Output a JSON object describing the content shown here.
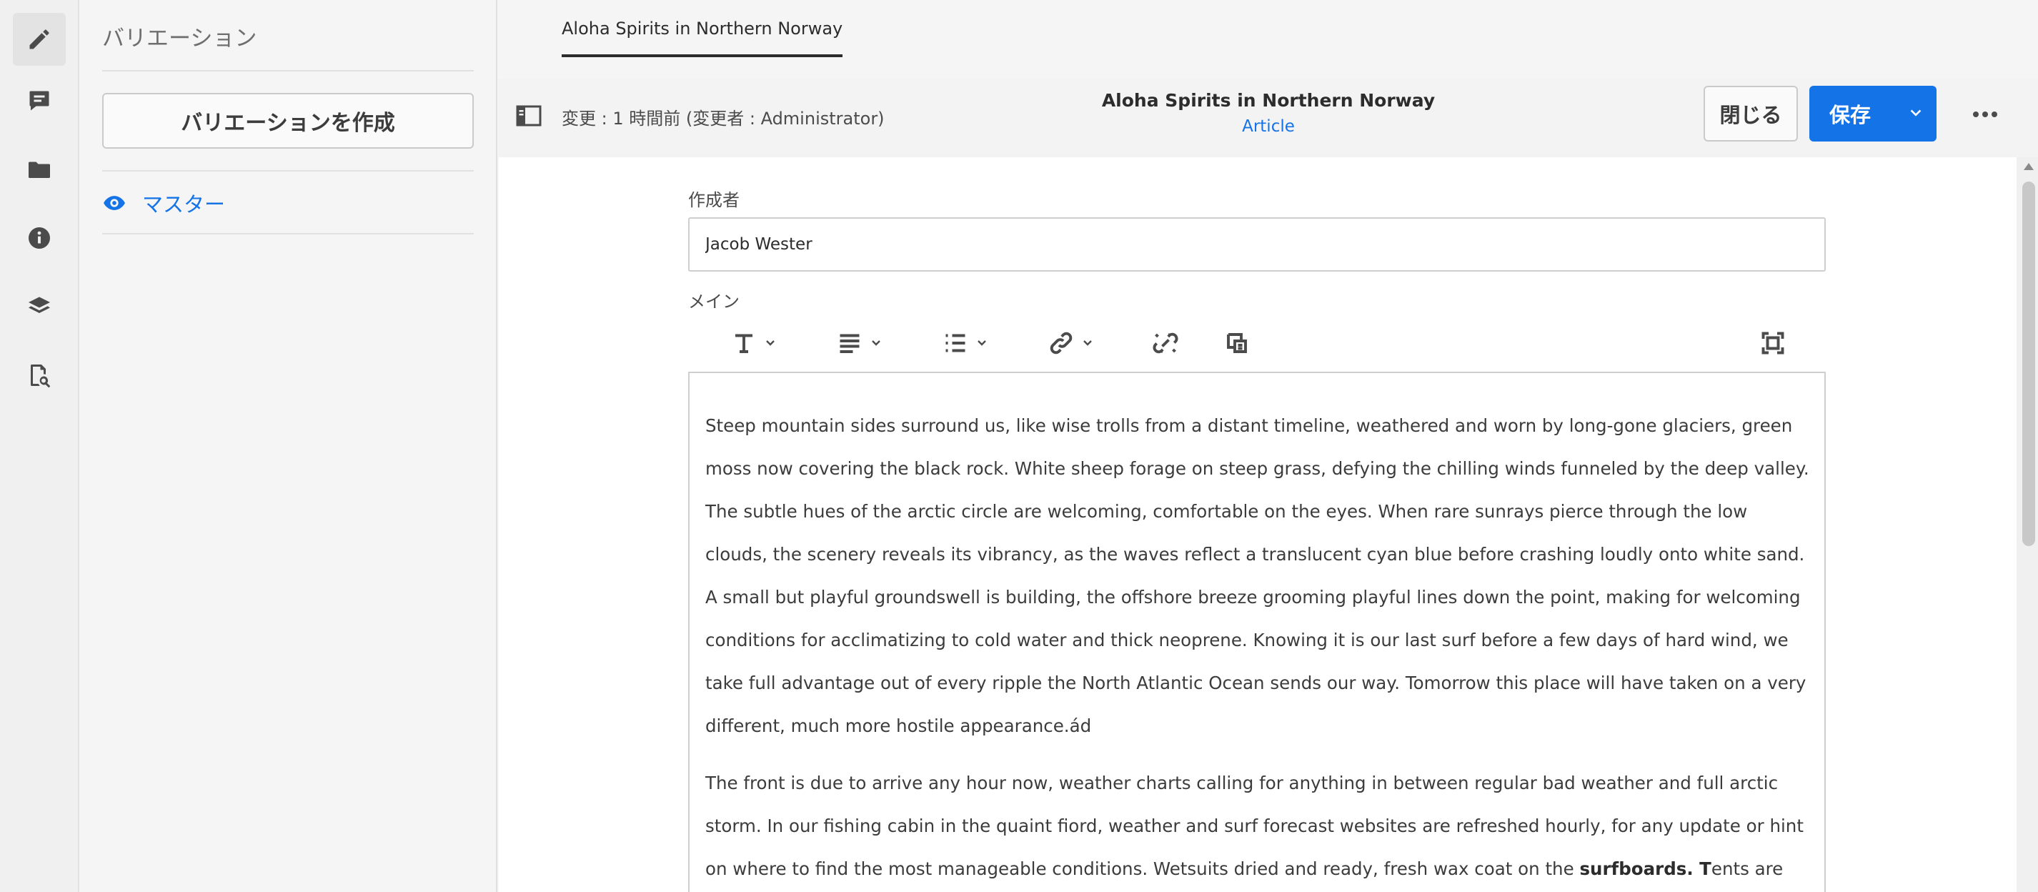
{
  "rail": {
    "items": [
      "edit-icon",
      "comment-icon",
      "folder-icon",
      "info-icon",
      "layers-icon",
      "search-doc-icon"
    ],
    "active": "edit-icon"
  },
  "variations": {
    "title": "バリエーション",
    "create_label": "バリエーションを作成",
    "master_label": "マスター"
  },
  "tabs": {
    "document_tab": "Aloha Spirits in Northern Norway"
  },
  "actionbar": {
    "modified": "変更 : 1 時間前 (変更者 : Administrator)",
    "title": "Aloha Spirits in Northern Norway",
    "model": "Article",
    "close_label": "閉じる",
    "save_label": "保存"
  },
  "form": {
    "author_label": "作成者",
    "author_value": "Jacob Wester",
    "main_label": "メイン"
  },
  "toolbar": {
    "items": [
      "text-format-icon",
      "align-icon",
      "list-icon",
      "link-icon",
      "unlink-icon",
      "paste-icon",
      "fullscreen-icon"
    ]
  },
  "content": {
    "paragraph1": "Steep mountain sides surround us, like wise trolls from a distant timeline, weathered and worn by long-gone glaciers, green moss now covering the black rock. White sheep forage on steep grass, defying the chilling winds funneled by the deep valley. The subtle hues of the arctic circle are welcoming, comfortable on the eyes. When rare sunrays pierce through the low clouds, the scenery reveals its vibrancy, as the waves reflect a translucent cyan blue before crashing loudly onto white sand. A small but playful groundswell is building, the offshore breeze grooming playful lines down the point, making for welcoming conditions for acclimatizing to cold water and thick neoprene. Knowing it is our last surf before a few days of hard wind, we take full advantage out of every ripple the North Atlantic Ocean sends our way. Tomorrow this place will have taken on a very different, much more hostile appearance.ád",
    "paragraph2_start": "The front is due to arrive any hour now, weather charts calling for anything in between regular bad weather and full arctic storm. In our fishing cabin in the quaint fiord, weather and surf forecast websites are refreshed hourly, for any update or hint on where to find the most manageable conditions. Wetsuits dried and ready, fresh wax coat on the ",
    "paragraph2_bold": "surfboards. T",
    "paragraph2_end": "ents are"
  },
  "colors": {
    "accent": "#1473e6",
    "rail_bg": "#f0f0f0",
    "panel_bg": "#f5f5f5",
    "editor_bg": "#ffffff"
  }
}
